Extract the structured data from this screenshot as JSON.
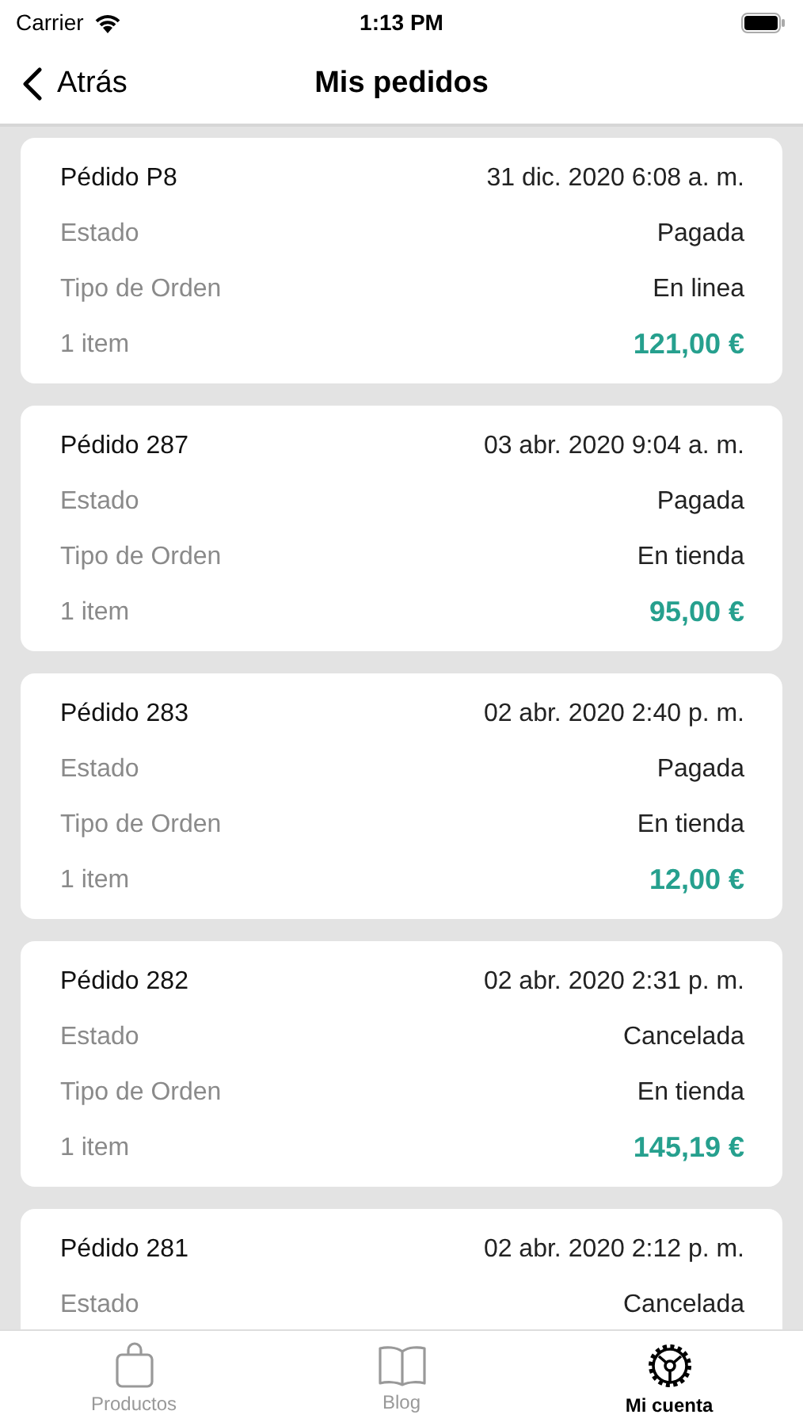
{
  "status_bar": {
    "carrier": "Carrier",
    "time": "1:13 PM"
  },
  "nav": {
    "back": "Atrás",
    "title": "Mis pedidos"
  },
  "orders": [
    {
      "title": "Pédido P8",
      "date": "31 dic. 2020 6:08 a. m.",
      "details": [
        {
          "label": "Estado",
          "value": "Pagada"
        },
        {
          "label": "Tipo de Orden",
          "value": "En linea"
        }
      ],
      "footer": {
        "count": "1 item",
        "total": "121,00 €"
      }
    },
    {
      "title": "Pédido 287",
      "date": "03 abr. 2020 9:04 a. m.",
      "details": [
        {
          "label": "Estado",
          "value": "Pagada"
        },
        {
          "label": "Tipo de Orden",
          "value": "En tienda"
        }
      ],
      "footer": {
        "count": "1 item",
        "total": "95,00 €"
      }
    },
    {
      "title": "Pédido 283",
      "date": "02 abr. 2020 2:40 p. m.",
      "details": [
        {
          "label": "Estado",
          "value": "Pagada"
        },
        {
          "label": "Tipo de Orden",
          "value": "En tienda"
        }
      ],
      "footer": {
        "count": "1 item",
        "total": "12,00 €"
      }
    },
    {
      "title": "Pédido 282",
      "date": "02 abr. 2020 2:31 p. m.",
      "details": [
        {
          "label": "Estado",
          "value": "Cancelada"
        },
        {
          "label": "Tipo de Orden",
          "value": "En tienda"
        }
      ],
      "footer": {
        "count": "1 item",
        "total": "145,19 €"
      }
    },
    {
      "title": "Pédido 281",
      "date": "02 abr. 2020 2:12 p. m.",
      "details": [
        {
          "label": "Estado",
          "value": "Cancelada"
        }
      ]
    }
  ],
  "tabs": [
    {
      "label": "Productos",
      "selected": false
    },
    {
      "label": "Blog",
      "selected": false
    },
    {
      "label": "Mi cuenta",
      "selected": true
    }
  ]
}
